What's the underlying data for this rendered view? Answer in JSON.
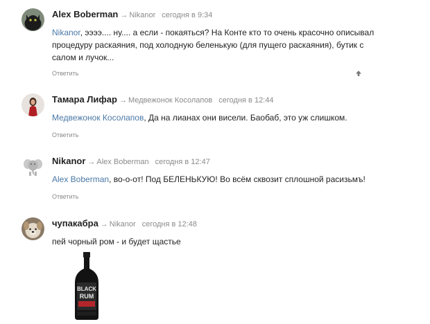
{
  "comments": [
    {
      "author": "Alex Boberman",
      "arrow": "→",
      "reply_to": "Nikanor",
      "time": "сегодня в 9:34",
      "mention": "Nikanor",
      "text_line1": ", ээээ.... ну.... а если - покаяться? На Конте кто то очень красочно описывал",
      "text_line2": "процедуру раскаяния, под холодную беленькую (для пущего раскаяния), бутик с",
      "text_line3": "салом и лучок...",
      "reply_label": "Ответить",
      "avatar_icon": "black-cat-avatar"
    },
    {
      "author": "Тамара Лифар",
      "arrow": "→",
      "reply_to": "Медвежонок Косолапов",
      "time": "сегодня в 12:44",
      "mention": "Медвежонок Косолапов",
      "text_line1": ", Да на лианах они висели. Баобаб, это уж слишком.",
      "reply_label": "Ответить",
      "avatar_icon": "woman-red-dress-avatar"
    },
    {
      "author": "Nikanor",
      "arrow": "→",
      "reply_to": "Alex Boberman",
      "time": "сегодня в 12:47",
      "mention": "Alex Boberman",
      "text_line1": ", во-о-от! Под БЕЛЕНЬКУЮ! Во всём сквозит сплошной расизьмъ!",
      "reply_label": "Ответить",
      "avatar_icon": "elephant-avatar"
    },
    {
      "author": "чупакабра",
      "arrow": "→",
      "reply_to": "Nikanor",
      "time": "сегодня в 12:48",
      "text_line1": "пей чорный ром - и будет щастье",
      "avatar_icon": "dog-avatar",
      "image": {
        "label_top": "BLACK",
        "label_bottom": "RUM"
      }
    }
  ],
  "colors": {
    "mention": "#4a78a6",
    "meta": "#8a8a8a",
    "text": "#222222"
  }
}
